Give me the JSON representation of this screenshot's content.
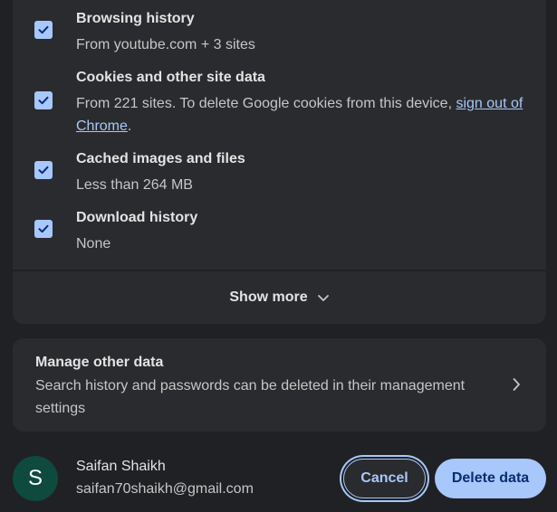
{
  "options": [
    {
      "title": "Browsing history",
      "desc": "From youtube.com + 3 sites",
      "checked": true
    },
    {
      "title": "Cookies and other site data",
      "desc_prefix": "From 221 sites. To delete Google cookies from this device, ",
      "link": "sign out of Chrome",
      "desc_suffix": ".",
      "checked": true
    },
    {
      "title": "Cached images and files",
      "desc": "Less than 264 MB",
      "checked": true
    },
    {
      "title": "Download history",
      "desc": "None",
      "checked": true
    }
  ],
  "show_more": {
    "label": "Show more"
  },
  "manage": {
    "title": "Manage other data",
    "desc": "Search history and passwords can be deleted in their management settings"
  },
  "account": {
    "initial": "S",
    "name": "Saifan Shaikh",
    "email": "saifan70shaikh@gmail.com"
  },
  "buttons": {
    "cancel": "Cancel",
    "delete": "Delete data"
  },
  "colors": {
    "background": "#202124",
    "card": "#2a2b2e",
    "accent": "#a8c7fa",
    "avatar": "#0e4a3e"
  },
  "icons": {
    "checkbox": "check-icon",
    "show_more": "chevron-down-icon",
    "manage": "chevron-right-icon"
  }
}
